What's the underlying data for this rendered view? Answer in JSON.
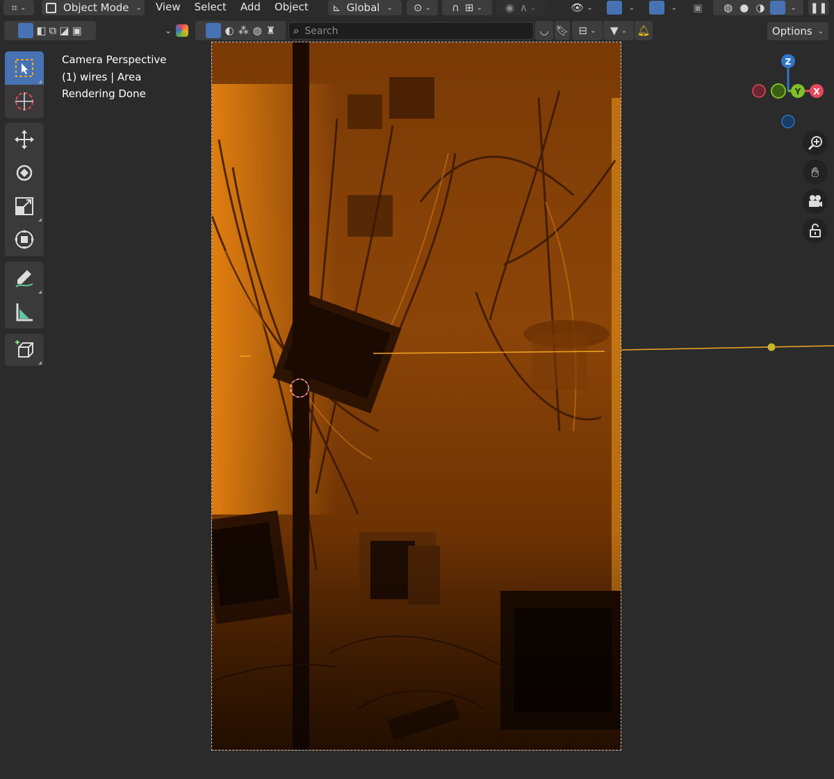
{
  "header": {
    "mode": "Object Mode",
    "menus": [
      "View",
      "Select",
      "Add",
      "Object"
    ],
    "transform_orientation": "Global"
  },
  "toolbar2": {
    "search_placeholder": "Search",
    "options_label": "Options"
  },
  "overlay": {
    "line1": "Camera Perspective",
    "line2": "(1) wires | Area",
    "line3": "Rendering Done"
  },
  "gizmo": {
    "z_label": "Z",
    "y_label": "Y",
    "x_label": "X"
  },
  "colors": {
    "accent": "#4772b3",
    "x_axis": "#e8485c",
    "y_axis": "#7fbf2a",
    "z_axis": "#2f76c9",
    "light_line": "#f5a623",
    "render_orange": "#8c4508"
  }
}
